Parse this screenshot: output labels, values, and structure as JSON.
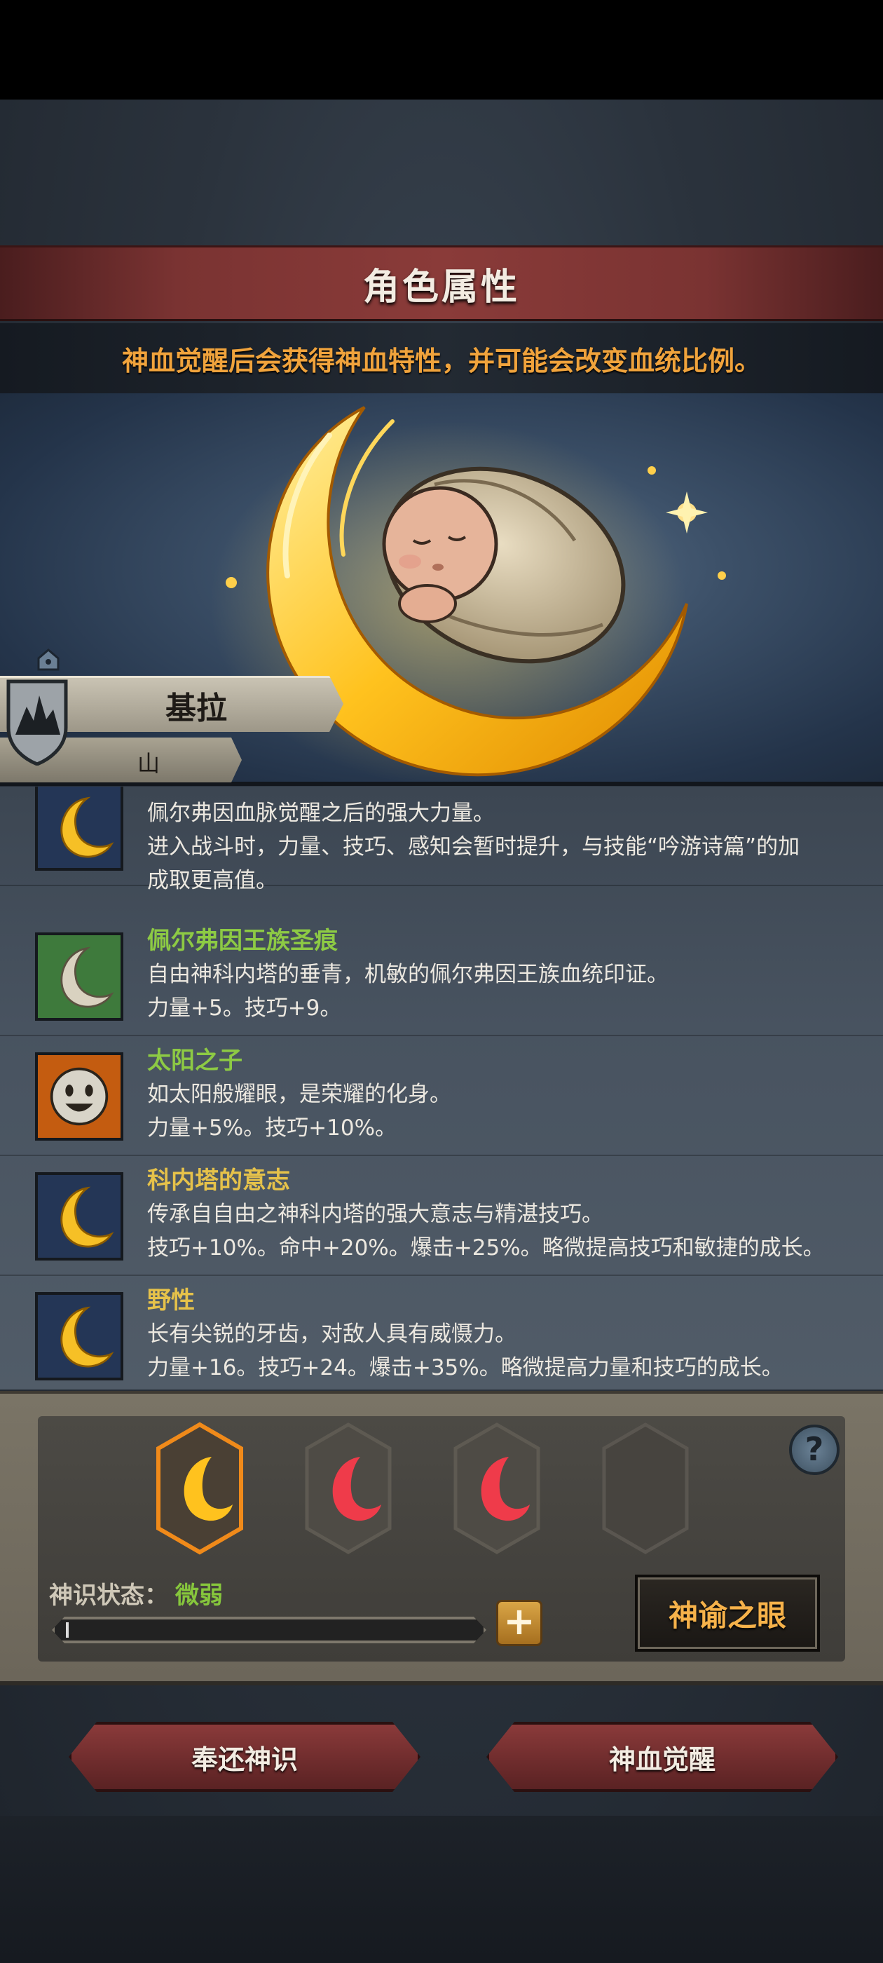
{
  "header": {
    "title": "角色属性",
    "hint": "神血觉醒后会获得神血特性，并可能会改变血统比例。"
  },
  "character": {
    "name": "基拉",
    "origin": "山"
  },
  "traits": [
    {
      "name": "",
      "icon": "moon-icon",
      "desc": "佩尔弗因血脉觉醒之后的强大力量。",
      "stat": "进入战斗时，力量、技巧、感知会暂时提升，与技能“吟游诗篇”的加",
      "stat2": "成取更高值。"
    },
    {
      "name": "佩尔弗因王族圣痕",
      "icon": "silver-moon-icon",
      "desc": "自由神科内塔的垂青，机敏的佩尔弗因王族血统印证。",
      "stat": "力量+5。技巧+9。"
    },
    {
      "name": "太阳之子",
      "icon": "sun-face-icon",
      "desc": "如太阳般耀眼，是荣耀的化身。",
      "stat": "力量+5%。技巧+10%。"
    },
    {
      "name": "科内塔的意志",
      "icon": "moon-icon",
      "desc": "传承自自由之神科内塔的强大意志与精湛技巧。",
      "stat": "技巧+10%。命中+20%。爆击+25%。略微提高技巧和敏捷的成长。"
    },
    {
      "name": "野性",
      "icon": "moon-icon",
      "desc": "长有尖锐的牙齿，对敌人具有威慑力。",
      "stat": "力量+16。技巧+24。爆击+35%。略微提高力量和技巧的成长。"
    }
  ],
  "divine": {
    "status_label": "神识状态：",
    "status_value": "微弱",
    "oracle_button": "神谕之眼",
    "help": "?",
    "plus": "+",
    "progress": 0.0,
    "slots": [
      "gold-crescent",
      "red-crescent",
      "red-crescent",
      "empty"
    ]
  },
  "actions": {
    "return_button": "奉还神识",
    "awaken_button": "神血觉醒"
  },
  "colors": {
    "title_red": "#8a3b39",
    "hint_orange": "#f0a33c",
    "green_name": "#8dca44",
    "gold_name": "#e6c24a"
  }
}
